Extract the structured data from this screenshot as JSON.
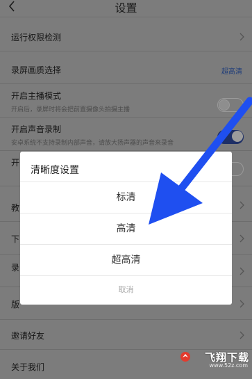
{
  "header": {
    "title": "设置"
  },
  "settings": {
    "run_permission": {
      "label": "运行权限检测"
    },
    "screen_quality": {
      "label": "录屏画质选择",
      "value": "超高清"
    },
    "anchor_mode": {
      "label": "开启主播模式",
      "desc": "开启后，录屏时将会把前置摄像头拍摄主播"
    },
    "audio_record": {
      "label": "开启声音录制",
      "desc": "安卓系统不支持录制内部声音，请放大扬声器的声音来录音"
    },
    "partial_1": "开",
    "partial_2": "教",
    "partial_3": "下",
    "partial_4": "录",
    "partial_5": "版",
    "invite": {
      "label": "邀请好友"
    },
    "about": {
      "label": "关于我们"
    }
  },
  "dialog": {
    "title": "清晰度设置",
    "options": [
      "标清",
      "高清",
      "超高清"
    ],
    "cancel": "取消"
  },
  "colors": {
    "arrow": "#1f4ff0",
    "toggle_on": "#1e2f66"
  },
  "watermark": {
    "main": "飞翔下载",
    "sub": "www.52z.com"
  }
}
